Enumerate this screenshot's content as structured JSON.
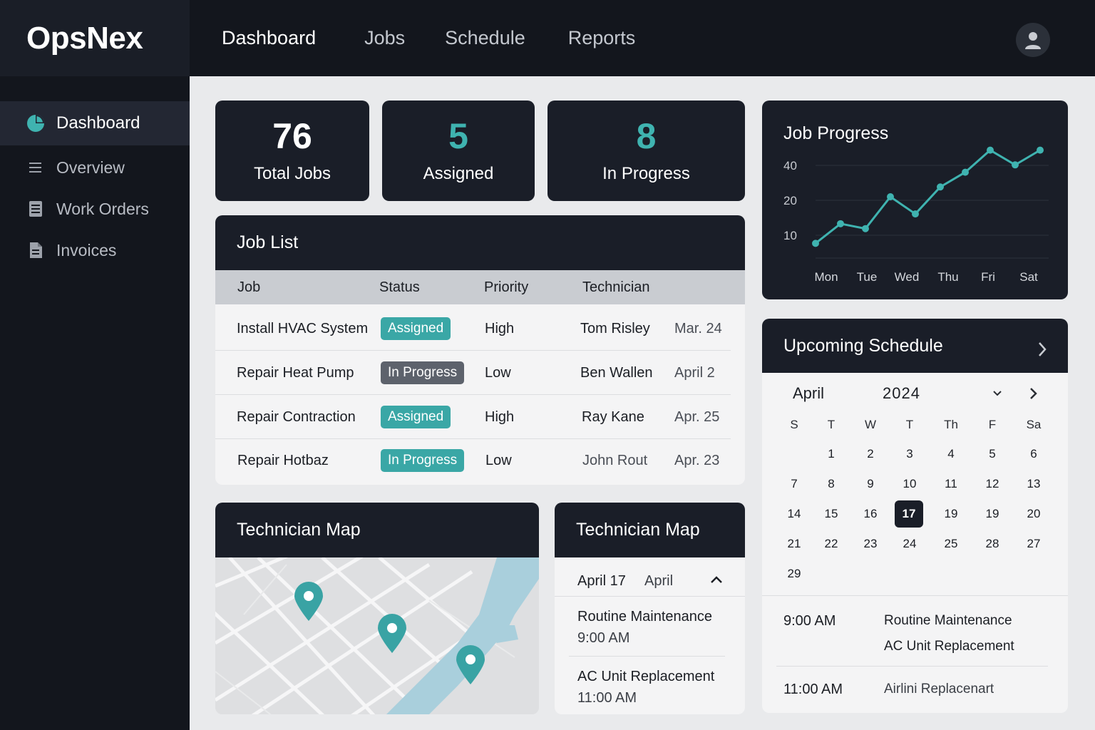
{
  "brand": "OpsNex",
  "topnav": [
    "Dashboard",
    "Jobs",
    "Schedule",
    "Reports"
  ],
  "sidebar": {
    "items": [
      {
        "label": "Dashboard",
        "icon": "pie-chart-icon"
      },
      {
        "label": "Overview",
        "icon": "menu-lines-icon"
      },
      {
        "label": "Work Orders",
        "icon": "list-doc-icon"
      },
      {
        "label": "Invoices",
        "icon": "document-icon"
      }
    ]
  },
  "stats": {
    "total": {
      "value": "76",
      "label": "Total Jobs"
    },
    "assigned": {
      "value": "5",
      "label": "Assigned"
    },
    "in_progress": {
      "value": "8",
      "label": "In Progress"
    }
  },
  "job_list": {
    "title": "Job List",
    "columns": [
      "Job",
      "Status",
      "Priority",
      "Technician"
    ],
    "rows": [
      {
        "job": "Install HVAC System",
        "status": "Assigned",
        "priority": "High",
        "tech": "Tom Risley",
        "date": "Mar. 24"
      },
      {
        "job": "Repair Heat Pump",
        "status": "In Progress",
        "priority": "Low",
        "tech": "Ben Wallen",
        "date": "April 2"
      },
      {
        "job": "Repair Contraction",
        "status": "Assigned",
        "priority": "High",
        "tech": "Ray Kane",
        "date": "Apr. 25"
      },
      {
        "job": "Repair Hotbaz",
        "status": "In Progress",
        "priority": "Low",
        "tech": "John Rout",
        "date": "Apr. 23"
      }
    ]
  },
  "chart_data": {
    "type": "line",
    "title": "Job Progress",
    "categories": [
      "Mon",
      "Tue",
      "Wed",
      "Thu",
      "Fri",
      "Sat"
    ],
    "y_ticks": [
      "40",
      "20",
      "10"
    ],
    "series": [
      {
        "values": [
          6,
          14,
          12,
          25,
          18,
          29,
          35,
          44,
          38,
          44
        ]
      }
    ],
    "color": "#3fb3b0"
  },
  "map": {
    "title": "Technician Map",
    "pins": 3
  },
  "tech_schedule": {
    "title": "Technician Map",
    "date": "April 17",
    "month": "April",
    "items": [
      {
        "name": "Routine Maintenance",
        "time": "9:00 AM"
      },
      {
        "name": "AC Unit Replacement",
        "time": "11:00 AM"
      }
    ]
  },
  "upcoming": {
    "title": "Upcoming Schedule",
    "month": "April",
    "year": "2024",
    "weekdays": [
      "S",
      "T",
      "W",
      "T",
      "Th",
      "F",
      "Sa"
    ],
    "weeks": [
      [
        "",
        "1",
        "2",
        "3",
        "4",
        "5",
        "6"
      ],
      [
        "7",
        "8",
        "9",
        "10",
        "11",
        "12",
        "13"
      ],
      [
        "14",
        "15",
        "16",
        "17",
        "19",
        "19",
        "20"
      ],
      [
        "21",
        "22",
        "23",
        "24",
        "25",
        "28",
        "27"
      ],
      [
        "29",
        "",
        "",
        "",
        "",
        "",
        ""
      ]
    ],
    "selected": "17",
    "events": [
      {
        "time": "9:00 AM",
        "lines": [
          "Routine Maintenance",
          "AC Unit Replacement"
        ]
      },
      {
        "time": "11:00 AM",
        "lines": [
          "Airlini Replacenart"
        ]
      }
    ]
  },
  "colors": {
    "teal": "#3fb3b0",
    "dark": "#1a1e28",
    "grey_badge": "#5d626c"
  }
}
